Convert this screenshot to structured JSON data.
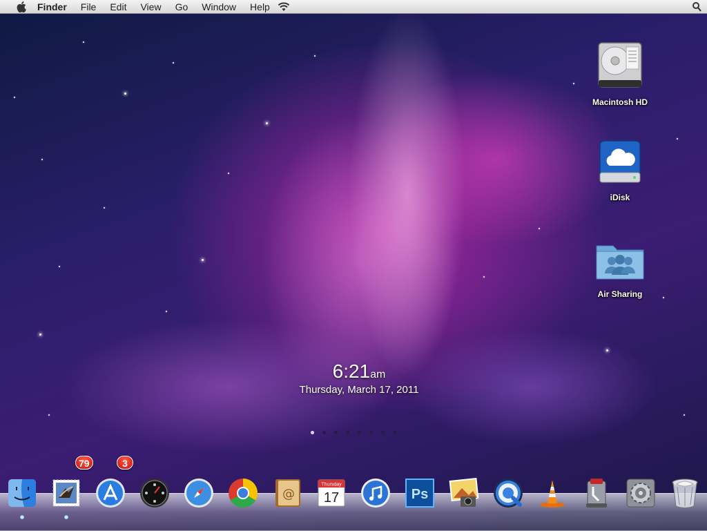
{
  "menubar": {
    "app_name": "Finder",
    "items": [
      "File",
      "Edit",
      "View",
      "Go",
      "Window",
      "Help"
    ]
  },
  "desktop": {
    "icons": [
      {
        "label": "Macintosh HD",
        "icon": "hard-drive-icon"
      },
      {
        "label": "iDisk",
        "icon": "idisk-icon"
      },
      {
        "label": "Air Sharing",
        "icon": "shared-folder-icon"
      }
    ]
  },
  "clock": {
    "time": "6:21",
    "ampm": "am",
    "date": "Thursday, March 17, 2011"
  },
  "pages": {
    "count": 8,
    "active": 0
  },
  "dock": {
    "items": [
      {
        "name": "finder",
        "icon": "finder-icon"
      },
      {
        "name": "mail",
        "icon": "mail-icon",
        "badge": "79"
      },
      {
        "name": "app-store",
        "icon": "app-store-icon",
        "badge": "3"
      },
      {
        "name": "dashboard",
        "icon": "dashboard-icon"
      },
      {
        "name": "safari",
        "icon": "safari-icon"
      },
      {
        "name": "chrome",
        "icon": "chrome-icon"
      },
      {
        "name": "address-book",
        "icon": "address-book-icon"
      },
      {
        "name": "ical",
        "icon": "calendar-icon",
        "cal_month": "Thursday",
        "cal_day": "17"
      },
      {
        "name": "itunes",
        "icon": "itunes-icon"
      },
      {
        "name": "photoshop",
        "icon": "photoshop-icon",
        "text": "Ps"
      },
      {
        "name": "iphoto",
        "icon": "iphoto-icon"
      },
      {
        "name": "quicktime",
        "icon": "quicktime-icon"
      },
      {
        "name": "vlc",
        "icon": "vlc-icon"
      },
      {
        "name": "time-machine",
        "icon": "time-machine-icon"
      },
      {
        "name": "system-preferences",
        "icon": "system-preferences-icon"
      },
      {
        "name": "trash",
        "icon": "trash-icon"
      }
    ]
  }
}
